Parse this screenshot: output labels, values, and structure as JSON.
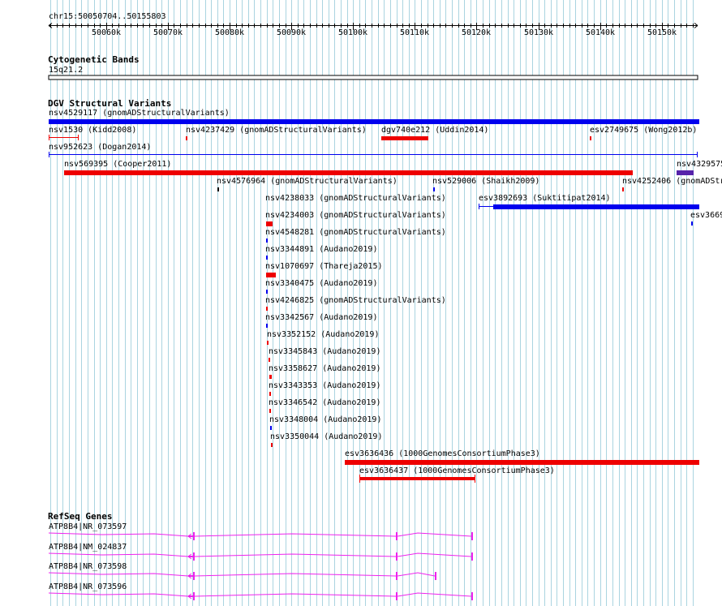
{
  "ruler": {
    "location": "chr15:50050704..50155803",
    "start": 50050704,
    "end": 50155803,
    "ticks": [
      {
        "pos": 50060000,
        "label": "50060k"
      },
      {
        "pos": 50070000,
        "label": "50070k"
      },
      {
        "pos": 50080000,
        "label": "50080k"
      },
      {
        "pos": 50090000,
        "label": "50090k"
      },
      {
        "pos": 50100000,
        "label": "50100k"
      },
      {
        "pos": 50110000,
        "label": "50110k"
      },
      {
        "pos": 50120000,
        "label": "50120k"
      },
      {
        "pos": 50130000,
        "label": "50130k"
      },
      {
        "pos": 50140000,
        "label": "50140k"
      },
      {
        "pos": 50150000,
        "label": "50150k"
      }
    ]
  },
  "cytoband": {
    "title": "Cytogenetic Bands",
    "band": "15q21.2"
  },
  "dgv": {
    "title": "DGV Structural Variants",
    "features": [
      {
        "id": "nsv4529117",
        "study": "(gnomADStructuralVariants)",
        "label": "nsv4529117 (gnomADStructuralVariants)",
        "color": "#0000ee"
      },
      {
        "id": "nsv1530",
        "study": "(Kidd2008)",
        "label": "nsv1530 (Kidd2008)",
        "color": "#ee0000"
      },
      {
        "id": "nsv4237429",
        "study": "(gnomADStructuralVariants)",
        "label": "nsv4237429 (gnomADStructuralVariants)",
        "color": "#ee0000"
      },
      {
        "id": "dgv740e212",
        "study": "(Uddin2014)",
        "label": "dgv740e212 (Uddin2014)",
        "color": "#ee0000"
      },
      {
        "id": "esv2749675",
        "study": "(Wong2012b)",
        "label": "esv2749675 (Wong2012b)",
        "color": "#ee0000"
      },
      {
        "id": "nsv952623",
        "study": "(Dogan2014)",
        "label": "nsv952623 (Dogan2014)",
        "color": "#0000ee"
      },
      {
        "id": "nsv569395",
        "study": "(Cooper2011)",
        "label": "nsv569395 (Cooper2011)",
        "color": "#ee0000"
      },
      {
        "id": "nsv4329575",
        "study": "",
        "label": "nsv4329575",
        "color": "#5522aa"
      },
      {
        "id": "nsv4576964",
        "study": "(gnomADStructuralVariants)",
        "label": "nsv4576964 (gnomADStructuralVariants)",
        "color": "#000000"
      },
      {
        "id": "nsv529006",
        "study": "(Shaikh2009)",
        "label": "nsv529006 (Shaikh2009)",
        "color": "#0000ee"
      },
      {
        "id": "nsv4252406",
        "study": "(gnomADStru",
        "label": "nsv4252406 (gnomADStru",
        "color": "#ee0000"
      },
      {
        "id": "nsv4238033",
        "study": "(gnomADStructuralVariants)",
        "label": "nsv4238033 (gnomADStructuralVariants)",
        "color": "#ee0000"
      },
      {
        "id": "esv3892693",
        "study": "(Suktitipat2014)",
        "label": "esv3892693 (Suktitipat2014)",
        "color": "#0000ee"
      },
      {
        "id": "nsv4234003",
        "study": "(gnomADStructuralVariants)",
        "label": "nsv4234003 (gnomADStructuralVariants)",
        "color": "#ee0000"
      },
      {
        "id": "esv3669",
        "study": "",
        "label": "esv3669",
        "color": "#0000ee"
      },
      {
        "id": "nsv4548281",
        "study": "(gnomADStructuralVariants)",
        "label": "nsv4548281 (gnomADStructuralVariants)",
        "color": "#0000ee"
      },
      {
        "id": "nsv3344891",
        "study": "(Audano2019)",
        "label": "nsv3344891 (Audano2019)",
        "color": "#0000ee"
      },
      {
        "id": "nsv1070697",
        "study": "(Thareja2015)",
        "label": "nsv1070697 (Thareja2015)",
        "color": "#ee0000"
      },
      {
        "id": "nsv3340475",
        "study": "(Audano2019)",
        "label": "nsv3340475 (Audano2019)",
        "color": "#0000ee"
      },
      {
        "id": "nsv4246825",
        "study": "(gnomADStructuralVariants)",
        "label": "nsv4246825 (gnomADStructuralVariants)",
        "color": "#ee0000"
      },
      {
        "id": "nsv3342567",
        "study": "(Audano2019)",
        "label": "nsv3342567 (Audano2019)",
        "color": "#0000ee"
      },
      {
        "id": "nsv3352152",
        "study": "(Audano2019)",
        "label": "nsv3352152 (Audano2019)",
        "color": "#ee0000"
      },
      {
        "id": "nsv3345843",
        "study": "(Audano2019)",
        "label": "nsv3345843 (Audano2019)",
        "color": "#ee0000"
      },
      {
        "id": "nsv3358627",
        "study": "(Audano2019)",
        "label": "nsv3358627 (Audano2019)",
        "color": "#ee0000"
      },
      {
        "id": "nsv3343353",
        "study": "(Audano2019)",
        "label": "nsv3343353 (Audano2019)",
        "color": "#ee0000"
      },
      {
        "id": "nsv3346542",
        "study": "(Audano2019)",
        "label": "nsv3346542 (Audano2019)",
        "color": "#ee0000"
      },
      {
        "id": "nsv3348004",
        "study": "(Audano2019)",
        "label": "nsv3348004 (Audano2019)",
        "color": "#0000ee"
      },
      {
        "id": "nsv3350044",
        "study": "(Audano2019)",
        "label": "nsv3350044 (Audano2019)",
        "color": "#ee0000"
      },
      {
        "id": "esv3636436",
        "study": "(1000GenomesConsortiumPhase3)",
        "label": "esv3636436 (1000GenomesConsortiumPhase3)",
        "color": "#ee0000"
      },
      {
        "id": "esv3636437",
        "study": "(1000GenomesConsortiumPhase3)",
        "label": "esv3636437 (1000GenomesConsortiumPhase3)",
        "color": "#ee0000"
      }
    ]
  },
  "refseq": {
    "title": "RefSeq Genes",
    "color": "#ee22ee",
    "transcripts": [
      {
        "label": "ATP8B4|NR_073597"
      },
      {
        "label": "ATP8B4|NM_024837"
      },
      {
        "label": "ATP8B4|NR_073598"
      },
      {
        "label": "ATP8B4|NR_073596"
      }
    ]
  },
  "colors": {
    "grid_line": "#aad4e0",
    "gain": "#0000ee",
    "loss": "#ee0000",
    "complex": "#5522aa",
    "gene": "#ee22ee"
  }
}
